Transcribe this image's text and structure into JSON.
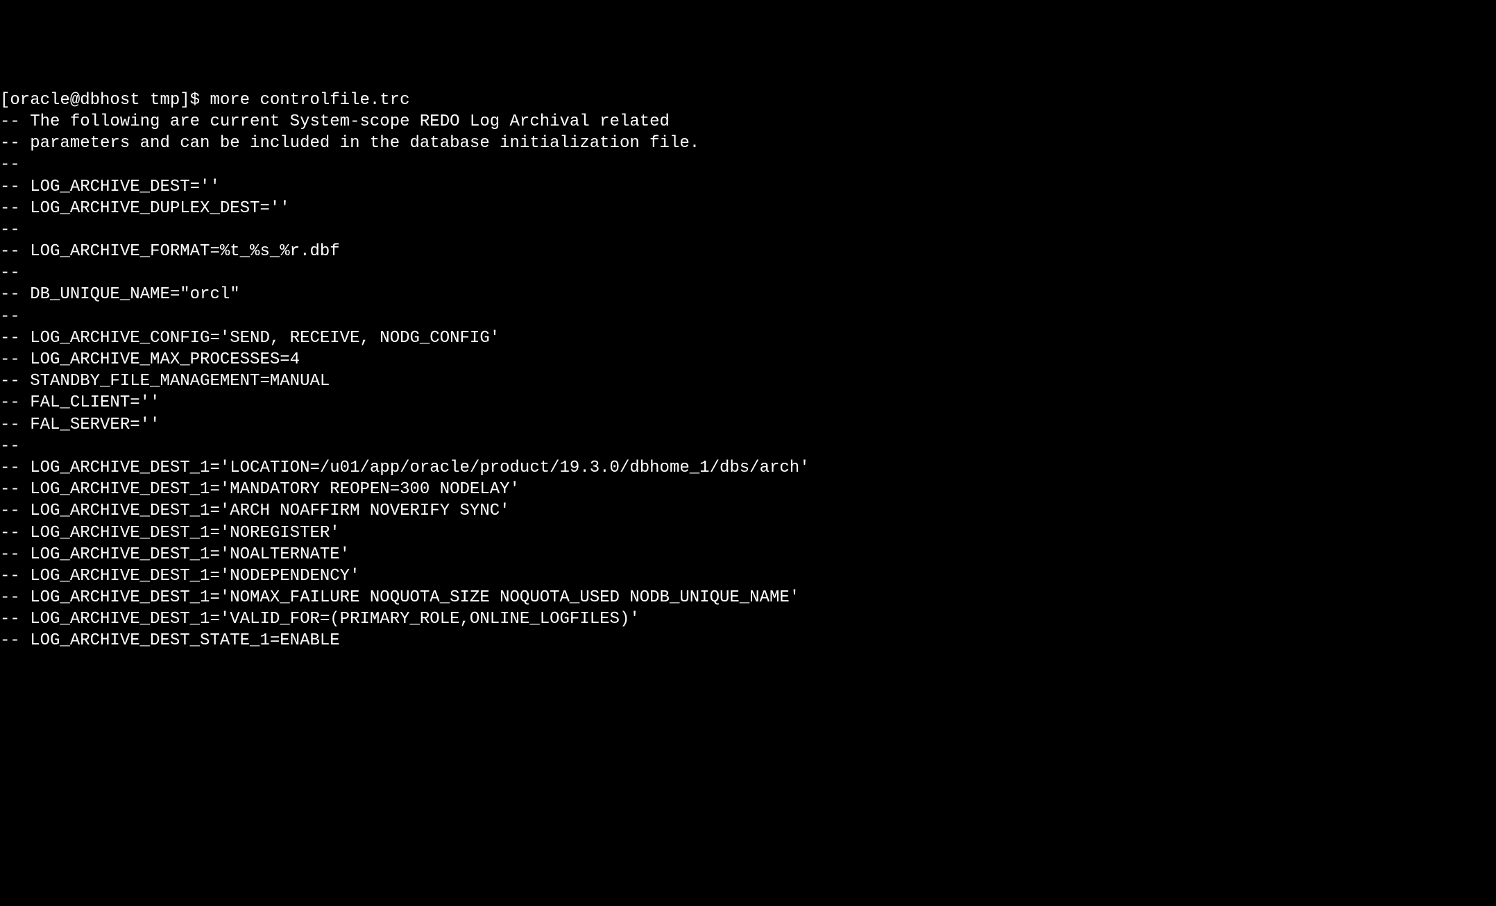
{
  "terminal": {
    "prompt": "[oracle@dbhost tmp]$ ",
    "command": "more controlfile.trc",
    "lines": [
      "-- The following are current System-scope REDO Log Archival related",
      "-- parameters and can be included in the database initialization file.",
      "--",
      "-- LOG_ARCHIVE_DEST=''",
      "-- LOG_ARCHIVE_DUPLEX_DEST=''",
      "--",
      "-- LOG_ARCHIVE_FORMAT=%t_%s_%r.dbf",
      "--",
      "-- DB_UNIQUE_NAME=\"orcl\"",
      "--",
      "-- LOG_ARCHIVE_CONFIG='SEND, RECEIVE, NODG_CONFIG'",
      "-- LOG_ARCHIVE_MAX_PROCESSES=4",
      "-- STANDBY_FILE_MANAGEMENT=MANUAL",
      "-- FAL_CLIENT=''",
      "-- FAL_SERVER=''",
      "--",
      "-- LOG_ARCHIVE_DEST_1='LOCATION=/u01/app/oracle/product/19.3.0/dbhome_1/dbs/arch'",
      "-- LOG_ARCHIVE_DEST_1='MANDATORY REOPEN=300 NODELAY'",
      "-- LOG_ARCHIVE_DEST_1='ARCH NOAFFIRM NOVERIFY SYNC'",
      "-- LOG_ARCHIVE_DEST_1='NOREGISTER'",
      "-- LOG_ARCHIVE_DEST_1='NOALTERNATE'",
      "-- LOG_ARCHIVE_DEST_1='NODEPENDENCY'",
      "-- LOG_ARCHIVE_DEST_1='NOMAX_FAILURE NOQUOTA_SIZE NOQUOTA_USED NODB_UNIQUE_NAME'",
      "-- LOG_ARCHIVE_DEST_1='VALID_FOR=(PRIMARY_ROLE,ONLINE_LOGFILES)'",
      "-- LOG_ARCHIVE_DEST_STATE_1=ENABLE"
    ]
  }
}
